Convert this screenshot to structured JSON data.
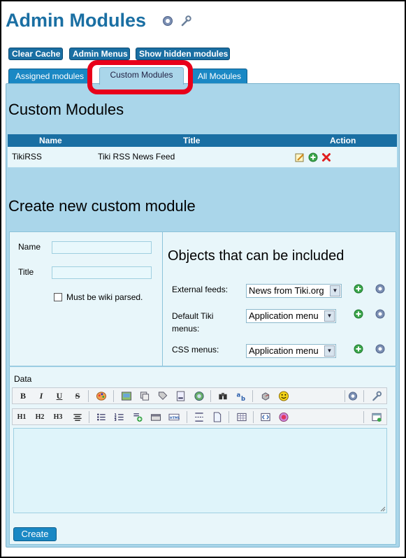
{
  "header": {
    "title": "Admin Modules",
    "help_icon": "help-icon",
    "wrench_icon": "wrench-icon"
  },
  "toolbar": {
    "clear_cache": "Clear Cache",
    "admin_menus": "Admin Menus",
    "show_hidden": "Show hidden modules"
  },
  "tabs": [
    {
      "label": "Assigned modules"
    },
    {
      "label": "Custom Modules",
      "active": true
    },
    {
      "label": "All Modules"
    }
  ],
  "custom_modules": {
    "heading": "Custom Modules",
    "columns": {
      "name": "Name",
      "title": "Title",
      "action": "Action"
    },
    "rows": [
      {
        "name": "TikiRSS",
        "title": "Tiki RSS News Feed",
        "actions": [
          "edit-icon",
          "add-icon",
          "delete-icon"
        ]
      }
    ]
  },
  "create": {
    "heading": "Create new custom module",
    "name_label": "Name",
    "title_label": "Title",
    "wiki_parsed_label": "Must be wiki parsed.",
    "objects_heading": "Objects that can be included",
    "external_feeds_label": "External feeds:",
    "external_feeds_value": "News from Tiki.org",
    "default_menus_label": "Default Tiki menus:",
    "default_menus_value": "Application menu",
    "css_menus_label": "CSS menus:",
    "css_menus_value": "Application menu",
    "data_label": "Data",
    "button": "Create"
  },
  "editor_toolbar": {
    "row1": [
      "B",
      "I",
      "U",
      "S"
    ],
    "row2": [
      "H1",
      "H2",
      "H3"
    ]
  },
  "colors": {
    "accent": "#1a6fa3",
    "panel": "#aad6ea",
    "highlight": "#e8001a"
  }
}
